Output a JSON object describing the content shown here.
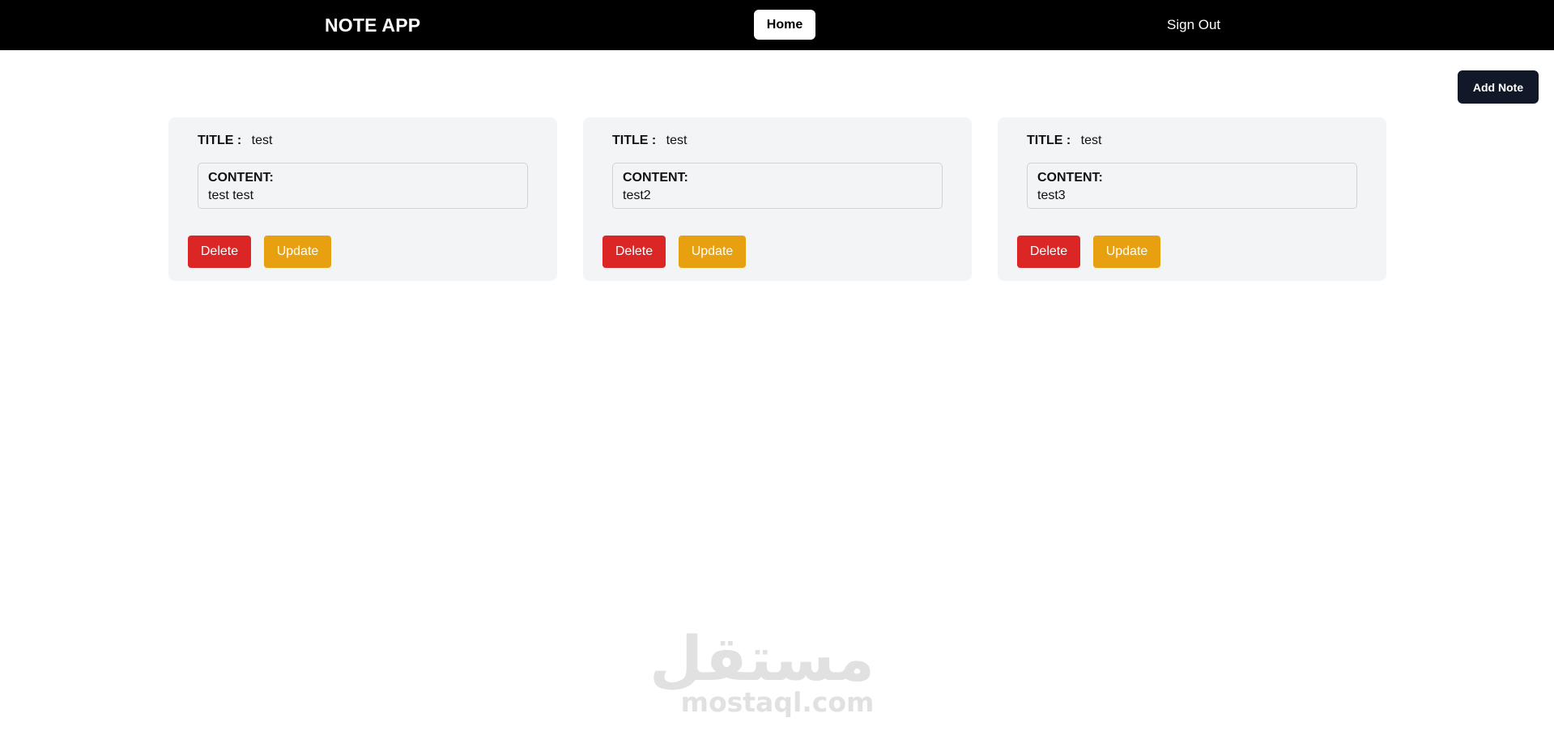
{
  "navbar": {
    "brand": "NOTE APP",
    "home_label": "Home",
    "signout_label": "Sign Out"
  },
  "actions": {
    "add_note_label": "Add Note"
  },
  "notes": [
    {
      "title_label": "TITLE :",
      "title": "test",
      "content_label": "CONTENT:",
      "content": "test test",
      "delete_label": "Delete",
      "update_label": "Update"
    },
    {
      "title_label": "TITLE :",
      "title": "test",
      "content_label": "CONTENT:",
      "content": "test2",
      "delete_label": "Delete",
      "update_label": "Update"
    },
    {
      "title_label": "TITLE :",
      "title": "test",
      "content_label": "CONTENT:",
      "content": "test3",
      "delete_label": "Delete",
      "update_label": "Update"
    }
  ],
  "watermark": {
    "logo_text": "مستقل",
    "text": "mostaql.com"
  },
  "colors": {
    "navbar_bg": "#000000",
    "card_bg": "#f3f4f6",
    "delete": "#dc2626",
    "update": "#e6a010",
    "add_note": "#111827"
  }
}
